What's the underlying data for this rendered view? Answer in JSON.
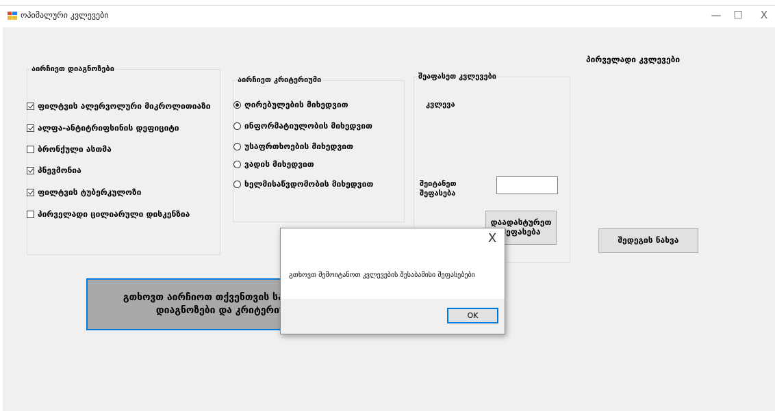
{
  "window": {
    "title": "ოპიმალური კვლევები",
    "minimize": "—",
    "maximize": "☐",
    "close": "X"
  },
  "diagnosis_group": {
    "title": "აირჩიეთ დიაგნოზები",
    "items": [
      {
        "label": "ფილტვის ალერვოლური მიკროლითიაზი",
        "checked": true
      },
      {
        "label": "ალფა-ანტიტრიფსინის დეფიციტი",
        "checked": true
      },
      {
        "label": "ბრონქული ასთმა",
        "checked": false
      },
      {
        "label": "პნევმონია",
        "checked": true
      },
      {
        "label": "ფილტვის ტუბერკულოზი",
        "checked": true
      },
      {
        "label": "პირველადი ცილიარული დისკენზია",
        "checked": false
      }
    ]
  },
  "criteria_group": {
    "title": "აირჩიეთ კრიტერიუმი",
    "options": [
      {
        "label": "ღირებულების მიხედვით",
        "checked": true
      },
      {
        "label": "ინფორმატიულობის მიხედვით",
        "checked": false
      },
      {
        "label": "უსაფრთხოების მიხედვით",
        "checked": false
      },
      {
        "label": "ვადის მიხედვით",
        "checked": false
      },
      {
        "label": "ხელმისაწვდომობის მიხედვით",
        "checked": false
      }
    ]
  },
  "evaluate_group": {
    "title": "შეაფასეთ კვლევები",
    "research_label": "კვლევა",
    "input_label": "შეიტანეთ შეფასება",
    "input_value": "",
    "confirm_button": "დაადასტურეთ შეფასება"
  },
  "initial": {
    "heading": "პირველადი კვლევები",
    "view_button": "შედეგის ნახვა"
  },
  "main_button": "გთხოვთ აირჩიოთ თქვენთვის სასურველი დიაგნოზები და კრიტერიუმი",
  "dialog": {
    "message": "გთხოვთ შემოიტანოთ კვლევების შესაბამისი შეფასებები",
    "ok": "OK",
    "close": "X"
  },
  "colors": {
    "accent": "#0078d7",
    "window_bg": "#f0f0f0",
    "main_button_bg": "#a9a9a9"
  }
}
